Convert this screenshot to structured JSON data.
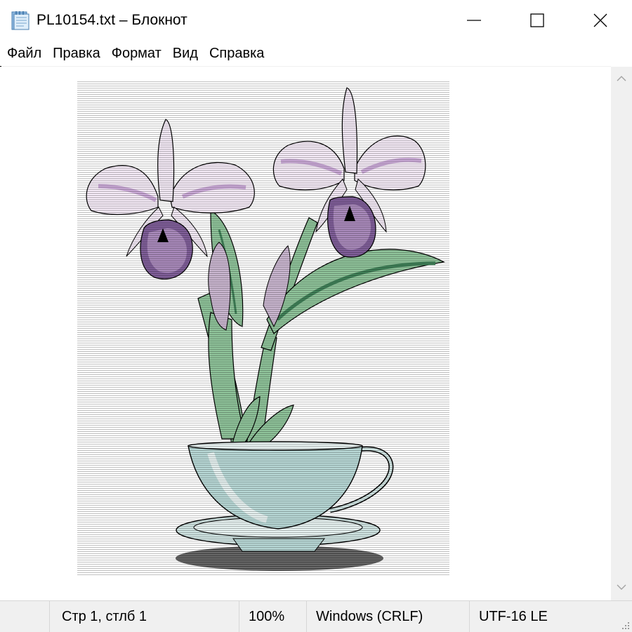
{
  "window": {
    "title": "PL10154.txt – Блокнот",
    "icon": "notepad-icon",
    "controls": [
      "minimize-icon",
      "maximize-icon",
      "close-icon"
    ]
  },
  "menu": {
    "items": [
      "Файл",
      "Правка",
      "Формат",
      "Вид",
      "Справка"
    ]
  },
  "editor": {
    "content": "ASCII-art illustration: two orchids in a teacup"
  },
  "status": {
    "position": "Стр 1, стлб 1",
    "zoom": "100%",
    "line_endings": "Windows (CRLF)",
    "encoding": "UTF-16 LE"
  },
  "colors": {
    "petal": "#c9a8d6",
    "lip": "#7f5e98",
    "leaf": "#8fc39a",
    "leaf_dark": "#3f7f57",
    "cup": "#b8d8d6",
    "shadow": "#707070"
  }
}
